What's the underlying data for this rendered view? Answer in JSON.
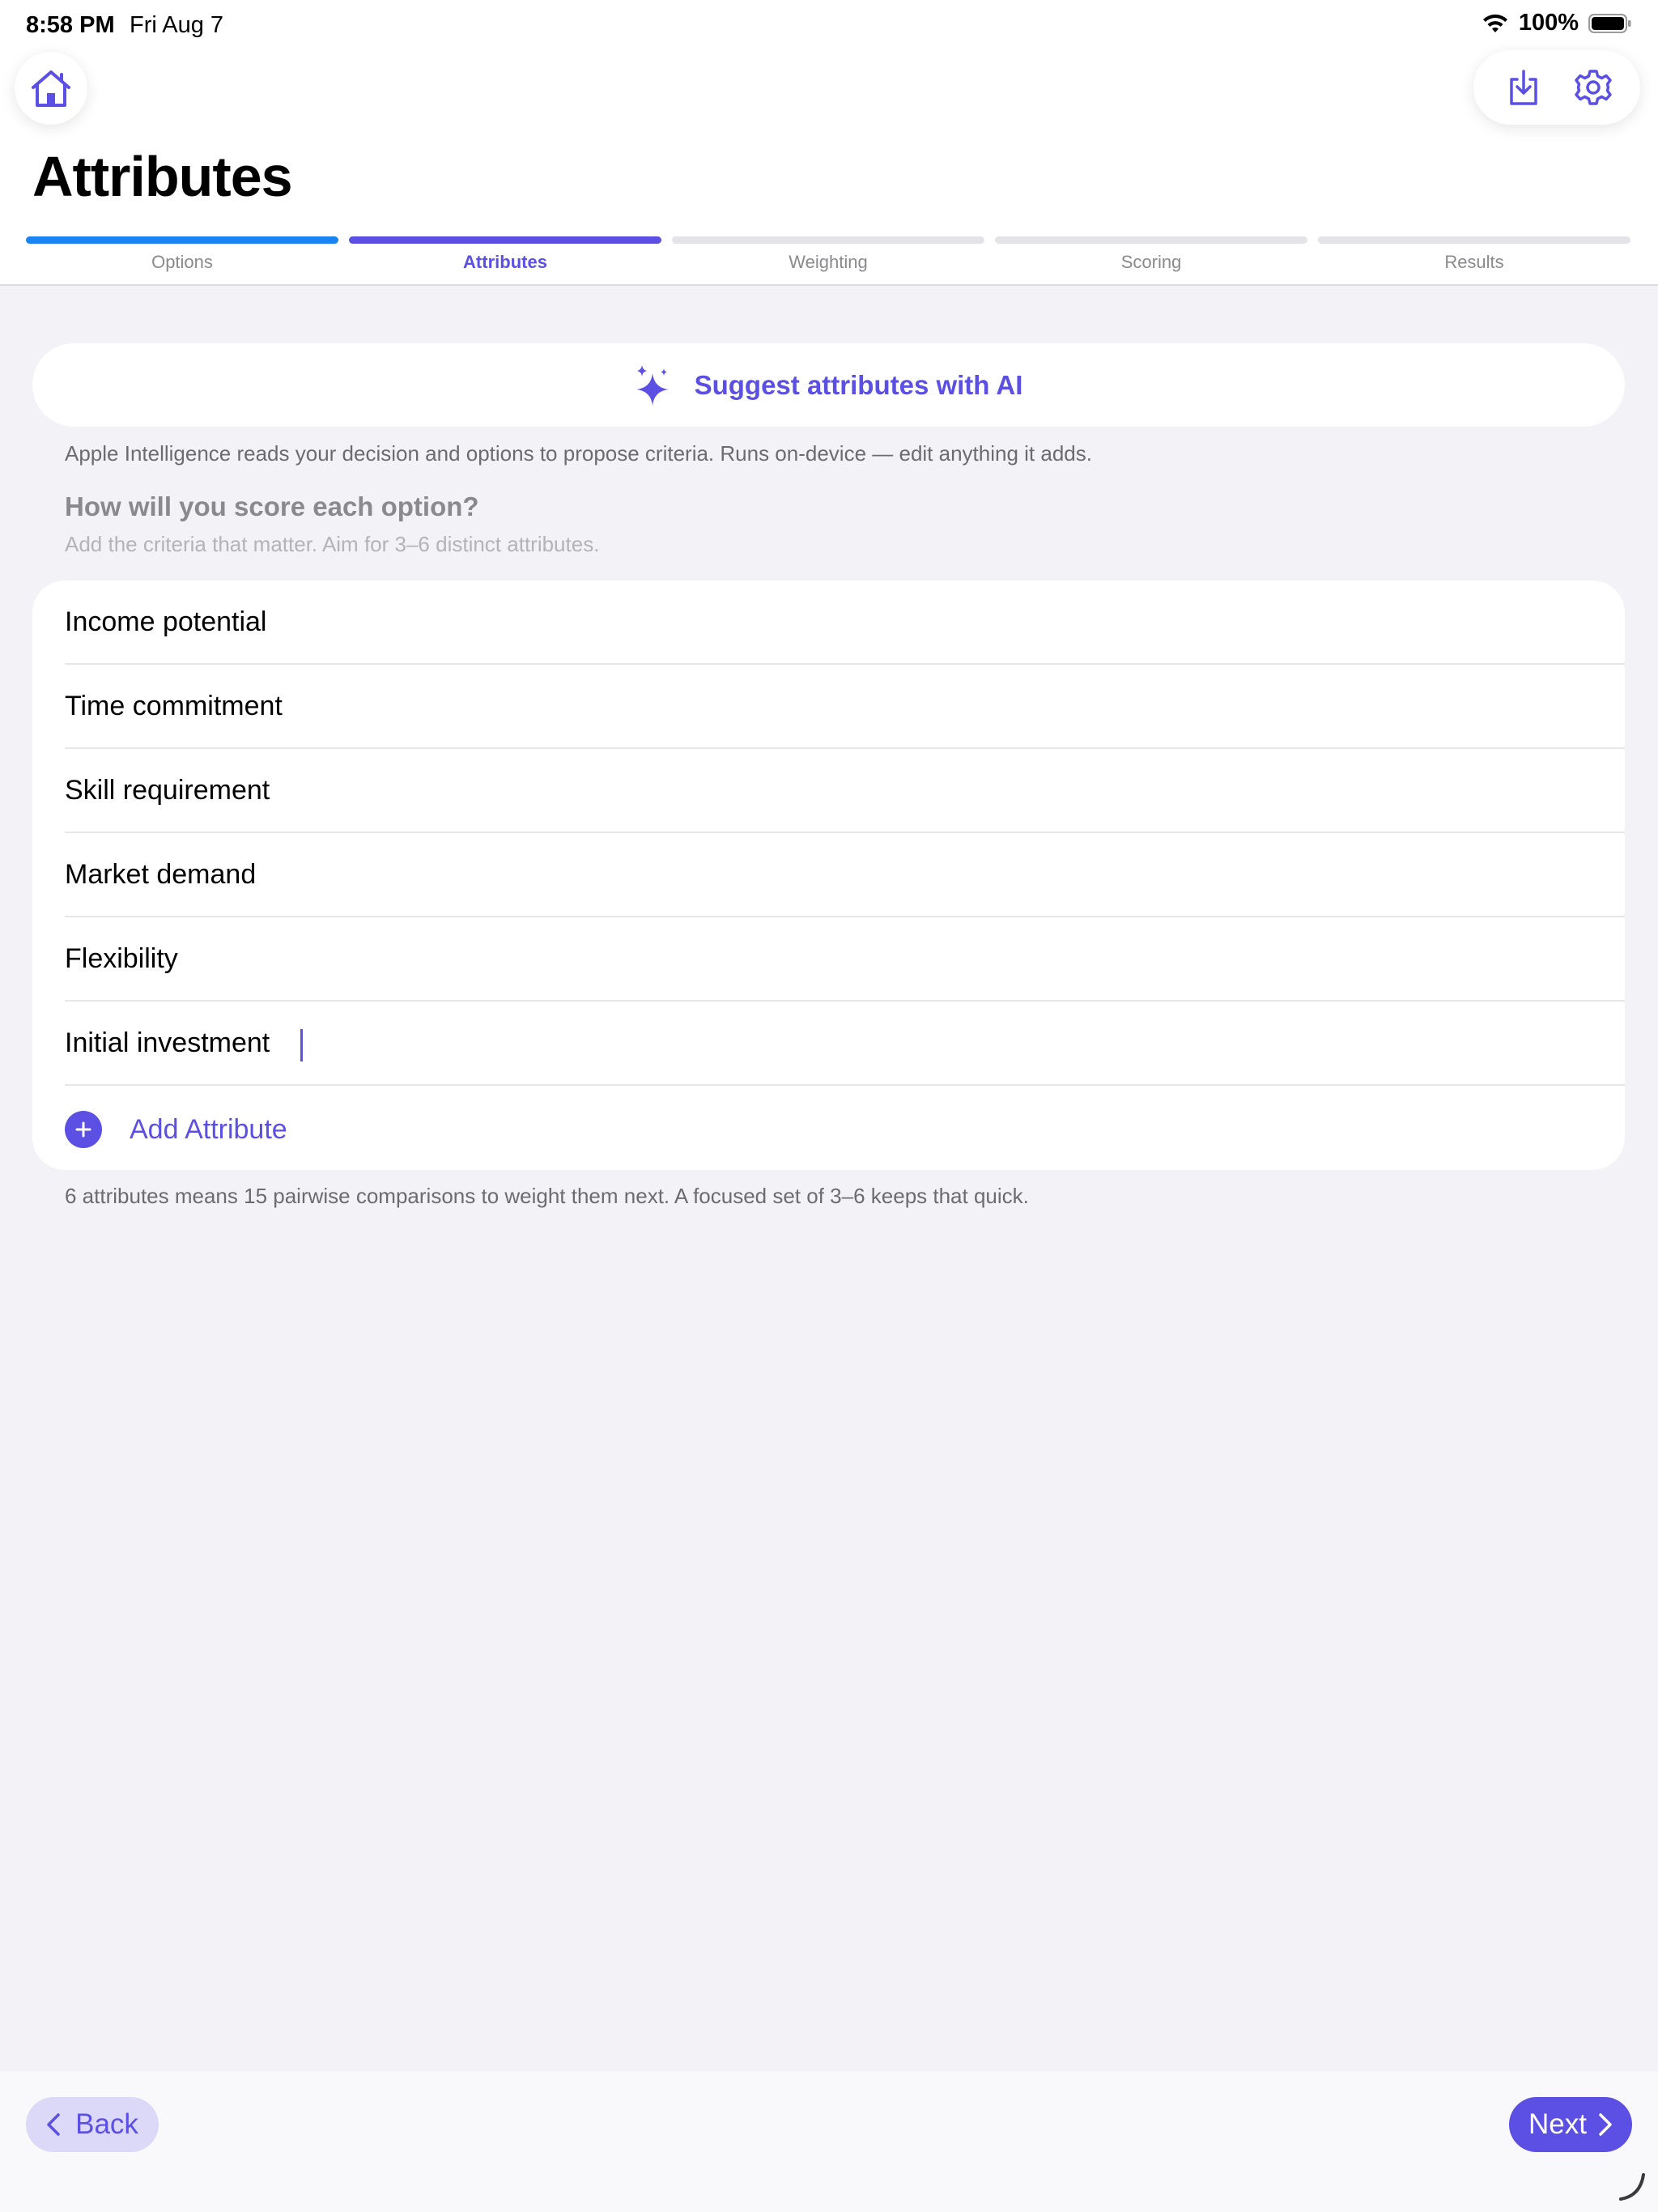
{
  "status_bar": {
    "time": "8:58 PM",
    "date": "Fri Aug 7",
    "battery": "100%",
    "icons": [
      "wifi-icon",
      "battery-icon"
    ]
  },
  "toolbar": {
    "home_icon": "home-icon",
    "download_icon": "download-icon",
    "settings_icon": "gear-icon"
  },
  "page_title": "Attributes",
  "steps": [
    {
      "label": "Options",
      "state": "done"
    },
    {
      "label": "Attributes",
      "state": "active"
    },
    {
      "label": "Weighting",
      "state": "pending"
    },
    {
      "label": "Scoring",
      "state": "pending"
    },
    {
      "label": "Results",
      "state": "pending"
    }
  ],
  "ai": {
    "button_label": "Suggest attributes with AI",
    "icon": "sparkles-icon",
    "note": "Apple Intelligence reads your decision and options to propose criteria. Runs on-device — edit anything it adds."
  },
  "section": {
    "title": "How will you score each option?",
    "subtitle": "Add the criteria that matter. Aim for 3–6 distinct attributes."
  },
  "attributes": [
    "Income potential",
    "Time commitment",
    "Skill requirement",
    "Market demand",
    "Flexibility",
    "Initial investment"
  ],
  "add_attribute_label": "Add Attribute",
  "footnote": "6 attributes means 15 pairwise comparisons to weight them next. A focused set of 3–6 keeps that quick.",
  "nav": {
    "back_label": "Back",
    "next_label": "Next"
  },
  "colors": {
    "accent": "#5b50e3",
    "done_step": "#1a84f2",
    "background": "#f2f2f7"
  }
}
